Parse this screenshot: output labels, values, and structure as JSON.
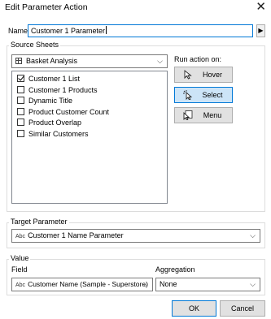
{
  "window": {
    "title": "Edit Parameter Action"
  },
  "name": {
    "label": "Name:",
    "value": "Customer 1 Parameter"
  },
  "source_sheets": {
    "group_label": "Source Sheets",
    "dashboard": "Basket Analysis",
    "sheets": [
      {
        "label": "Customer 1 List",
        "checked": true
      },
      {
        "label": "Customer 1 Products",
        "checked": false
      },
      {
        "label": "Dynamic Title",
        "checked": false
      },
      {
        "label": "Product Customer Count",
        "checked": false
      },
      {
        "label": "Product Overlap",
        "checked": false
      },
      {
        "label": "Similar Customers",
        "checked": false
      }
    ]
  },
  "run_action": {
    "label": "Run action on:",
    "options": [
      "Hover",
      "Select",
      "Menu"
    ],
    "selected": "Select"
  },
  "target_parameter": {
    "group_label": "Target Parameter",
    "type_badge": "Abc",
    "value": "Customer 1 Name Parameter"
  },
  "value_section": {
    "group_label": "Value",
    "field_label": "Field",
    "field_badge": "Abc",
    "field_value": "Customer Name (Sample - Superstore)",
    "aggregation_label": "Aggregation",
    "aggregation_value": "None"
  },
  "buttons": {
    "ok": "OK",
    "cancel": "Cancel"
  },
  "colors": {
    "accent": "#0078d7",
    "selected_bg": "#cce4f7"
  }
}
